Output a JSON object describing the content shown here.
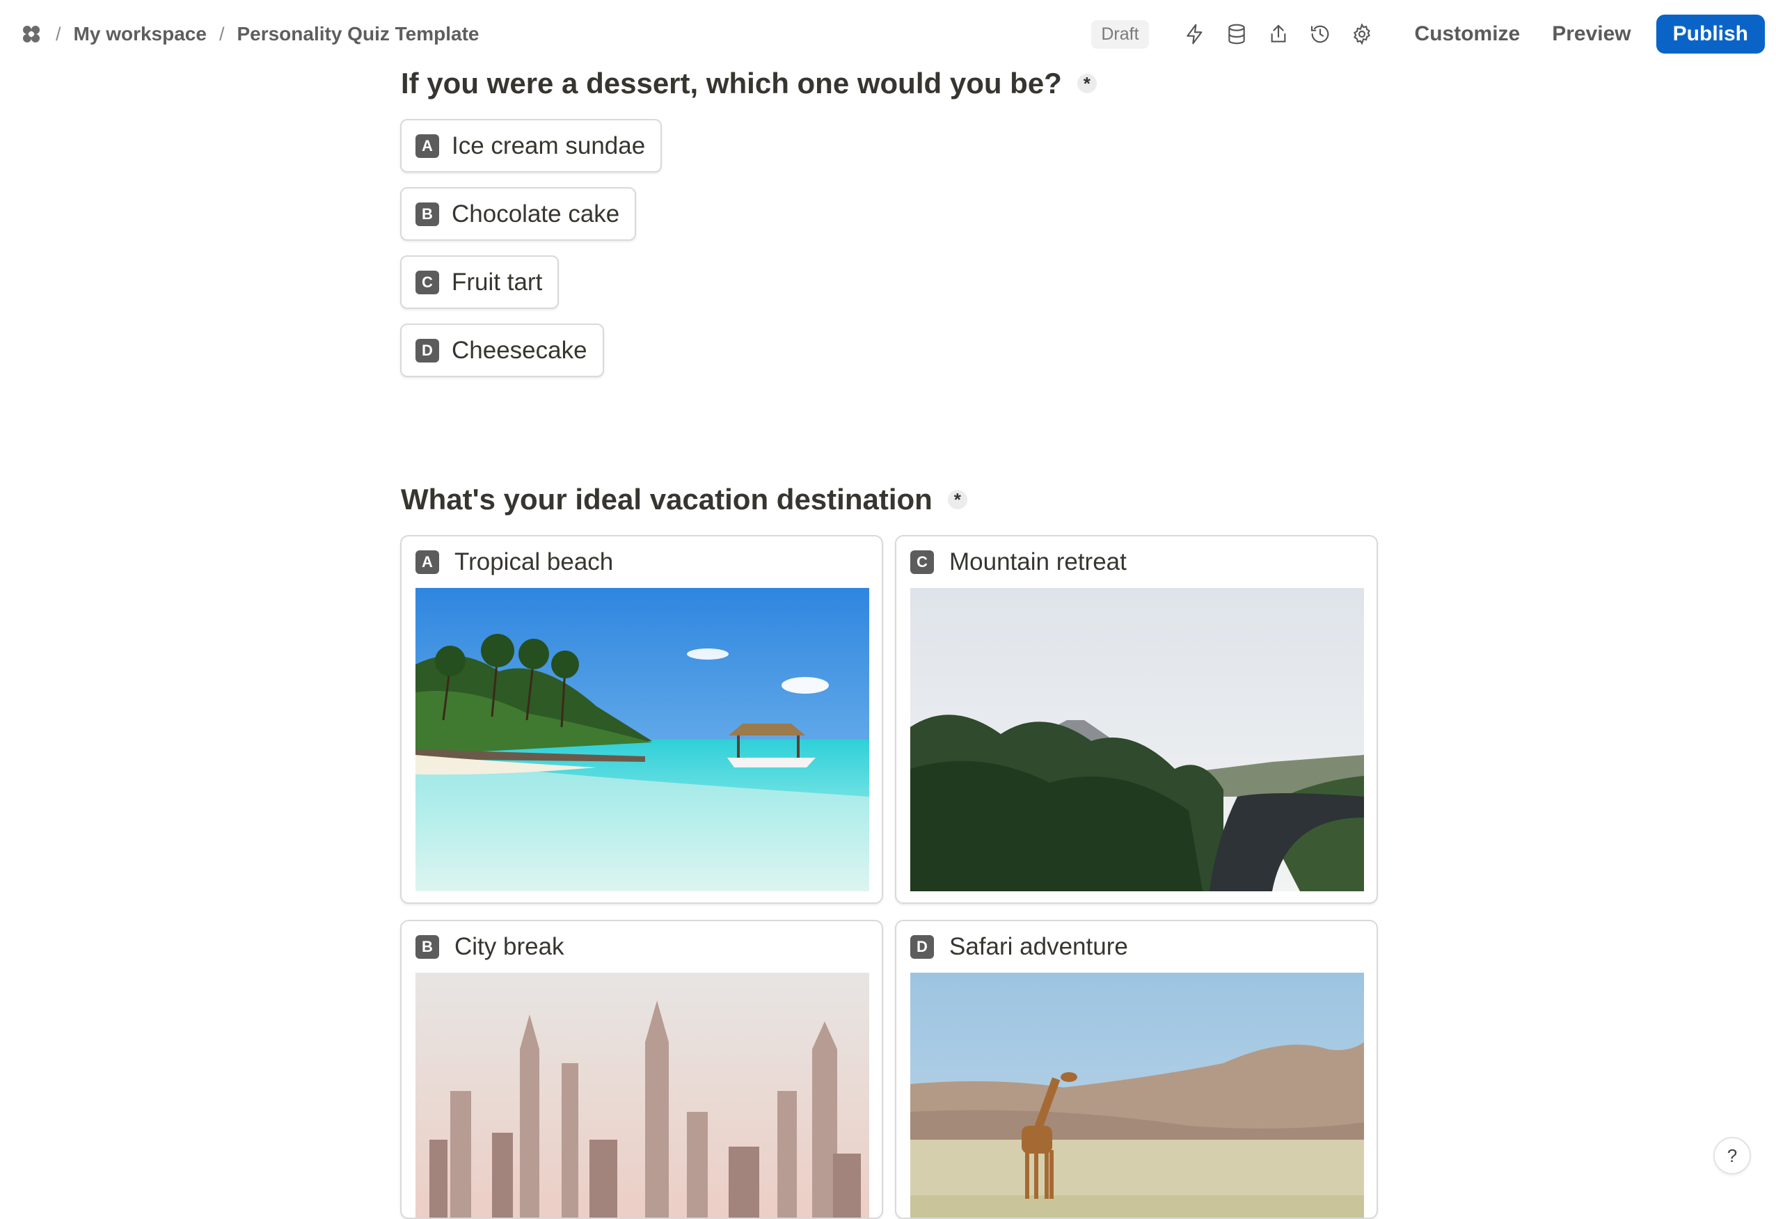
{
  "header": {
    "breadcrumb": [
      "My workspace",
      "Personality Quiz Template"
    ],
    "status_badge": "Draft",
    "icons": [
      "lightning-icon",
      "database-icon",
      "share-icon",
      "history-icon",
      "settings-icon"
    ],
    "customize_label": "Customize",
    "preview_label": "Preview",
    "publish_label": "Publish",
    "accent_color": "#0a64c8"
  },
  "questions": [
    {
      "title": "If you were a dessert, which one would you be?",
      "required_mark": "*",
      "choices": [
        {
          "key": "A",
          "label": "Ice cream sundae"
        },
        {
          "key": "B",
          "label": "Chocolate cake"
        },
        {
          "key": "C",
          "label": "Fruit tart"
        },
        {
          "key": "D",
          "label": "Cheesecake"
        }
      ]
    },
    {
      "title": "What's your ideal vacation destination",
      "required_mark": "*",
      "choices": [
        {
          "key": "A",
          "label": "Tropical beach"
        },
        {
          "key": "C",
          "label": "Mountain retreat"
        },
        {
          "key": "B",
          "label": "City break"
        },
        {
          "key": "D",
          "label": "Safari adventure"
        }
      ]
    }
  ],
  "help_label": "?"
}
